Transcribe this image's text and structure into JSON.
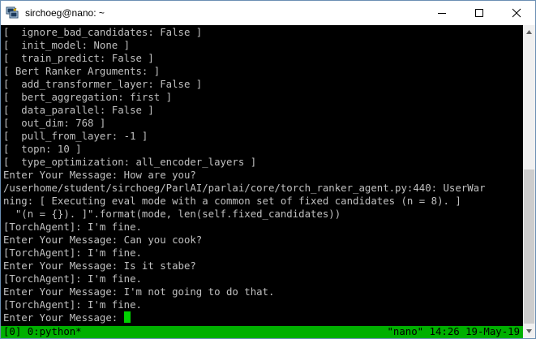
{
  "window": {
    "title": "sirchoeg@nano: ~"
  },
  "terminal": {
    "lines": [
      "[  ignore_bad_candidates: False ]",
      "[  init_model: None ]",
      "[  train_predict: False ]",
      "[ Bert Ranker Arguments: ]",
      "[  add_transformer_layer: False ]",
      "[  bert_aggregation: first ]",
      "[  data_parallel: False ]",
      "[  out_dim: 768 ]",
      "[  pull_from_layer: -1 ]",
      "[  topn: 10 ]",
      "[  type_optimization: all_encoder_layers ]",
      "Enter Your Message: How are you?",
      "/userhome/student/sirchoeg/ParlAI/parlai/core/torch_ranker_agent.py:440: UserWar",
      "ning: [ Executing eval mode with a common set of fixed candidates (n = 8). ]",
      "  \"(n = {}). ]\".format(mode, len(self.fixed_candidates))",
      "[TorchAgent]: I'm fine.",
      "Enter Your Message: Can you cook?",
      "[TorchAgent]: I'm fine.",
      "Enter Your Message: Is it stabe?",
      "[TorchAgent]: I'm fine.",
      "Enter Your Message: I'm not going to do that.",
      "[TorchAgent]: I'm fine."
    ],
    "prompt": "Enter Your Message: "
  },
  "statusbar": {
    "left": "[0] 0:python*",
    "right": "\"nano\" 14:26 19-May-19"
  },
  "colors": {
    "terminal_bg": "#000000",
    "terminal_fg": "#c0c0c0",
    "status_bg": "#00b000",
    "cursor": "#00d000"
  }
}
